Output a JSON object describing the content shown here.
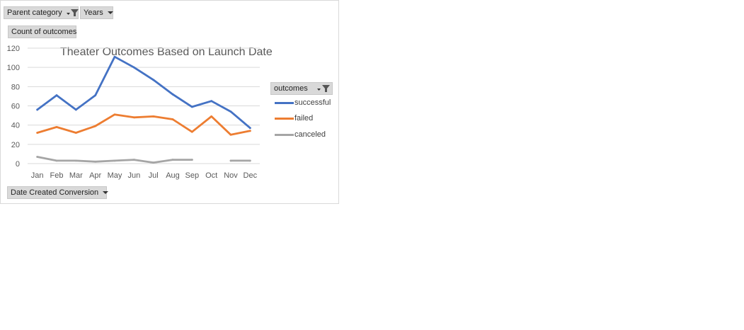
{
  "filters": {
    "parent_category": "Parent category",
    "years": "Years",
    "value_field": "Count of outcomes",
    "axis_field": "Date Created Conversion",
    "legend_field": "outcomes"
  },
  "colors": {
    "successful": "#4472C4",
    "failed": "#ED7D31",
    "canceled": "#A5A5A5",
    "grid": "#d9d9d9",
    "button_bg": "#d9d9d9"
  },
  "chart_data": {
    "type": "line",
    "title": "Theater Outcomes Based on Launch Date",
    "xlabel": "",
    "ylabel": "",
    "categories": [
      "Jan",
      "Feb",
      "Mar",
      "Apr",
      "May",
      "Jun",
      "Jul",
      "Aug",
      "Sep",
      "Oct",
      "Nov",
      "Dec"
    ],
    "ylim": [
      0,
      120
    ],
    "yticks": [
      0,
      20,
      40,
      60,
      80,
      100,
      120
    ],
    "grid": true,
    "legend_position": "right",
    "series": [
      {
        "name": "successful",
        "values": [
          56,
          71,
          56,
          71,
          111,
          100,
          87,
          72,
          59,
          65,
          54,
          37
        ]
      },
      {
        "name": "failed",
        "values": [
          32,
          38,
          32,
          39,
          51,
          48,
          49,
          46,
          33,
          49,
          30,
          34
        ]
      },
      {
        "name": "canceled",
        "values": [
          7,
          3,
          3,
          2,
          3,
          4,
          1,
          4,
          4,
          null,
          3,
          3
        ]
      }
    ]
  }
}
